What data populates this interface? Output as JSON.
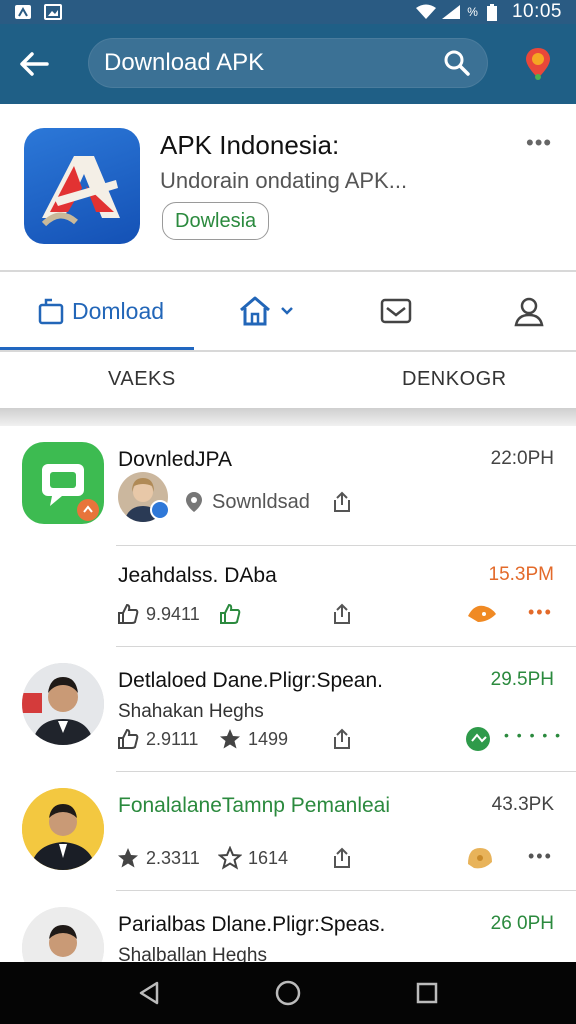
{
  "status_bar": {
    "battery_text": "%",
    "time": "10:05"
  },
  "search": {
    "value": "Download APK"
  },
  "app": {
    "name": "APK Indonesia:",
    "subtitle": "Undorain ondating APK...",
    "action_label": "Dowlesia",
    "more": "•••"
  },
  "tabs": [
    {
      "label": "Domload"
    }
  ],
  "subtabs": [
    "VAEKS",
    "DENKOGR"
  ],
  "items": [
    {
      "title": "DovnledJPA",
      "subtitle": "Sownldsad",
      "time": "22:0PH"
    },
    {
      "title": "Jeahdalss. DAba",
      "time": "15.3PM",
      "stat1": "9.9411"
    },
    {
      "title": "Detlaloed Dane.Pligr:Spean.",
      "subtitle": "Shahakan Heghs",
      "time": "29.5PH",
      "stat1": "2.9111",
      "stat2": "1499"
    },
    {
      "title": "FonalalaneTamnp Pemanleai",
      "time": "43.3PK",
      "stat1": "2.3311",
      "stat2": "1614"
    },
    {
      "title": "Parialbas Dlane.Pligr:Speas.",
      "subtitle": "Shalballan Heghs",
      "time": "26 0PH"
    }
  ],
  "colors": {
    "appbar": "#1f5f86",
    "accent_blue": "#2266b8",
    "accent_green": "#2b8a3e",
    "accent_orange": "#e36a2a"
  }
}
